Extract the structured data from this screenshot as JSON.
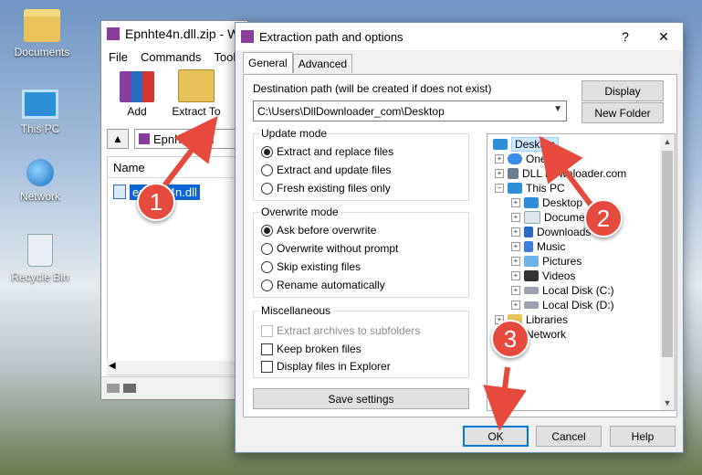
{
  "desktop": {
    "icons": [
      "Documents",
      "This PC",
      "Network",
      "Recycle Bin"
    ]
  },
  "winrar": {
    "title": "Epnhte4n.dll.zip - W",
    "menu": [
      "File",
      "Commands",
      "Tools"
    ],
    "tools": [
      "Add",
      "Extract To"
    ],
    "address": "Epnhte4n.d",
    "column_name": "Name",
    "file_name": "epnhte4n.dll"
  },
  "dialog": {
    "title": "Extraction path and options",
    "help_glyph": "?",
    "close_glyph": "✕",
    "tabs": [
      "General",
      "Advanced"
    ],
    "dest_label": "Destination path (will be created if does not exist)",
    "dest_value": "C:\\Users\\DllDownloader_com\\Desktop",
    "display_button": "Display",
    "new_folder_button": "New Folder",
    "update_mode": {
      "title": "Update mode",
      "options": [
        "Extract and replace files",
        "Extract and update files",
        "Fresh existing files only"
      ],
      "selected": 0
    },
    "overwrite_mode": {
      "title": "Overwrite mode",
      "options": [
        "Ask before overwrite",
        "Overwrite without prompt",
        "Skip existing files",
        "Rename automatically"
      ],
      "selected": 0
    },
    "misc": {
      "title": "Miscellaneous",
      "options": [
        "Extract archives to subfolders",
        "Keep broken files",
        "Display files in Explorer"
      ]
    },
    "save_settings": "Save settings",
    "tree": [
      "Desktop",
      "OneD",
      "DLL Downloader.com",
      "This PC",
      "Desktop",
      "Documents",
      "Downloads",
      "Music",
      "Pictures",
      "Videos",
      "Local Disk (C:)",
      "Local Disk (D:)",
      "Libraries",
      "Network"
    ],
    "ok": "OK",
    "cancel": "Cancel",
    "help": "Help"
  },
  "markers": [
    "1",
    "2",
    "3"
  ],
  "colors": {
    "marker": "#e64a3c",
    "selection": "#0a64d8",
    "accent": "#0078d7"
  }
}
